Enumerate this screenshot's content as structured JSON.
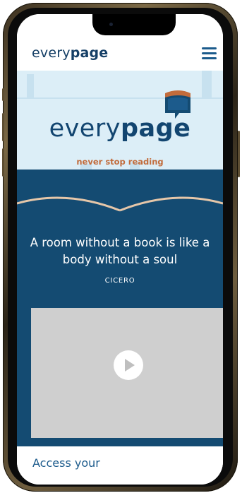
{
  "header": {
    "logo_regular": "every",
    "logo_bold": "page",
    "menu_icon": "hamburger-icon"
  },
  "hero": {
    "logo_regular": "every",
    "logo_bold": "page",
    "tagline": "never stop reading",
    "logo_icon": "book-speech-bubble-icon"
  },
  "quote": {
    "text": "A room without a book is like a body without a soul",
    "author": "CICERO"
  },
  "video": {
    "play_icon": "play-icon"
  },
  "footer": {
    "heading_partial": "Access your"
  },
  "colors": {
    "navy": "#144b72",
    "hero_bg": "#dceef7",
    "accent_orange": "#c26c3c",
    "link_blue": "#1c5b8c"
  }
}
